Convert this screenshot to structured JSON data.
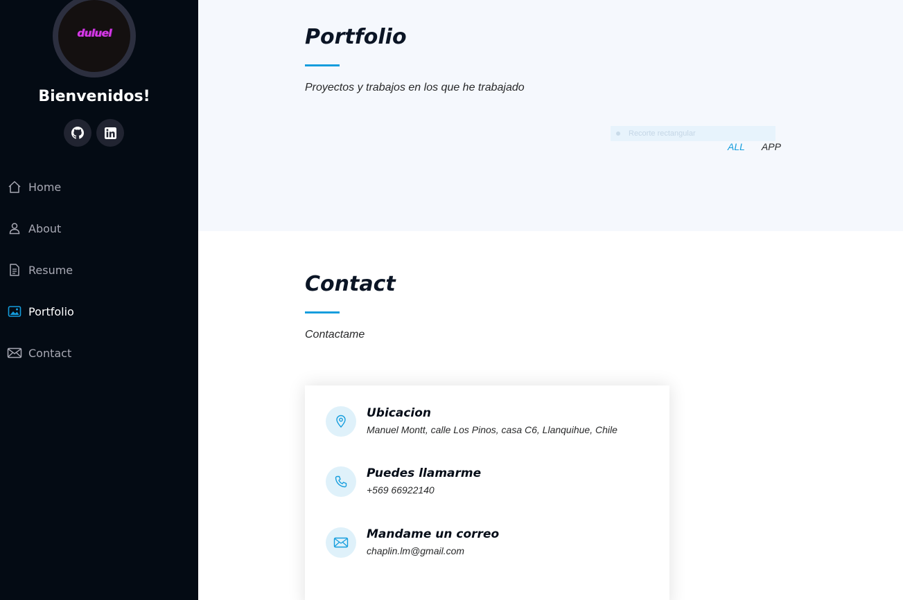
{
  "sidebar": {
    "logo_text": "duluel",
    "welcome": "Bienvenidos!",
    "social": [
      {
        "name": "github-icon"
      },
      {
        "name": "linkedin-icon"
      }
    ],
    "nav": [
      {
        "label": "Home",
        "icon": "home-icon"
      },
      {
        "label": "About",
        "icon": "person-icon"
      },
      {
        "label": "Resume",
        "icon": "file-icon"
      },
      {
        "label": "Portfolio",
        "icon": "image-icon",
        "active": true
      },
      {
        "label": "Contact",
        "icon": "envelope-icon"
      }
    ]
  },
  "portfolio": {
    "title": "Portfolio",
    "subtitle": "Proyectos y trabajos en los que he trabajado",
    "overlay_chip": "Recorte rectangular",
    "filters": [
      "ALL",
      "APP"
    ],
    "active_filter": "ALL"
  },
  "contact": {
    "title": "Contact",
    "subtitle": "Contactame",
    "items": [
      {
        "title": "Ubicacion",
        "text": "Manuel Montt, calle Los Pinos, casa C6, Llanquihue, Chile",
        "icon": "map-pin-icon"
      },
      {
        "title": "Puedes llamarme",
        "text": "+569 66922140",
        "icon": "phone-icon"
      },
      {
        "title": "Mandame un correo",
        "text": "chaplin.lm@gmail.com",
        "icon": "envelope-icon"
      }
    ]
  },
  "colors": {
    "accent": "#149ddd",
    "sidebar_bg": "#040b14",
    "section_bg": "#f5f8fd"
  }
}
